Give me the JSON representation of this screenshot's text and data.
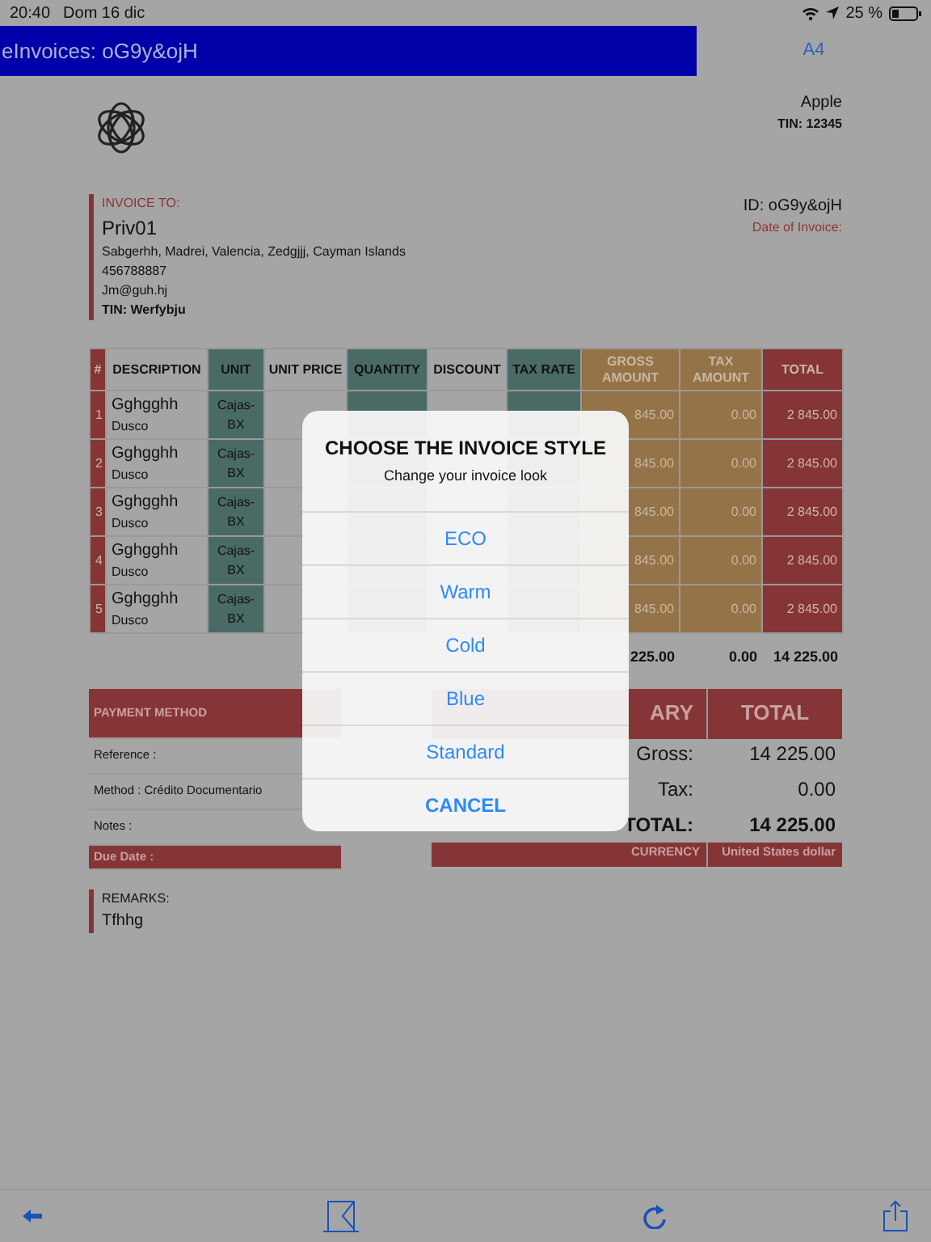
{
  "status_bar": {
    "time": "20:40",
    "date": "Dom 16 dic",
    "battery": "25 %"
  },
  "title_bar": {
    "title": "eInvoices: oG9y&ojH",
    "format_button": "A4"
  },
  "seller": {
    "name": "Apple",
    "tin": "TIN: 12345"
  },
  "bill_to": {
    "label": "INVOICE TO:",
    "name": "Priv01",
    "address": "Sabgerhh, Madrei, Valencia, Zedgjjj, Cayman Islands",
    "phone": "456788887",
    "email": "Jm@guh.hj",
    "tin": "TIN: Werfybju"
  },
  "invoice_meta": {
    "id": "ID: oG9y&ojH",
    "date_label": "Date of Invoice:"
  },
  "table": {
    "columns": [
      {
        "label": "#",
        "color": "#853535"
      },
      {
        "label": "DESCRIPTION",
        "color": "#a5a5a5"
      },
      {
        "label": "UNIT",
        "color": "#4a6a66"
      },
      {
        "label": "UNIT PRICE",
        "color": "#a5a5a5"
      },
      {
        "label": "QUANTITY",
        "color": "#4a6a66"
      },
      {
        "label": "DISCOUNT",
        "color": "#a5a5a5"
      },
      {
        "label": "TAX RATE",
        "color": "#4a6a66"
      },
      {
        "label": "GROSS AMOUNT",
        "color": "#957348"
      },
      {
        "label": "TAX AMOUNT",
        "color": "#957348"
      },
      {
        "label": "TOTAL",
        "color": "#853535"
      }
    ],
    "rows": [
      {
        "number": "1",
        "name": "Gghgghh",
        "detail": "Dusco",
        "unit": "Cajas-BX",
        "gross": "845.00",
        "tax": "0.00",
        "total": "2 845.00"
      },
      {
        "number": "2",
        "name": "Gghgghh",
        "detail": "Dusco",
        "unit": "Cajas-BX",
        "gross": "845.00",
        "tax": "0.00",
        "total": "2 845.00"
      },
      {
        "number": "3",
        "name": "Gghgghh",
        "detail": "Dusco",
        "unit": "Cajas-BX",
        "gross": "845.00",
        "tax": "0.00",
        "total": "2 845.00"
      },
      {
        "number": "4",
        "name": "Gghgghh",
        "detail": "Dusco",
        "unit": "Cajas-BX",
        "gross": "845.00",
        "tax": "0.00",
        "total": "2 845.00"
      },
      {
        "number": "5",
        "name": "Gghgghh",
        "detail": "Dusco",
        "unit": "Cajas-BX",
        "gross": "845.00",
        "tax": "0.00",
        "total": "2 845.00"
      }
    ],
    "totals": {
      "gross": "225.00",
      "tax": "0.00",
      "total": "14 225.00"
    }
  },
  "payment": {
    "title": "PAYMENT METHOD",
    "lines": [
      "Reference :",
      "Method : Crédito Documentario",
      "Notes :"
    ],
    "due_date": "Due Date :"
  },
  "summary": {
    "title": "ARY",
    "total_heading": "TOTAL",
    "lines": [
      {
        "kind": "plain",
        "label": "Gross:",
        "value": "14 225.00"
      },
      {
        "kind": "plain",
        "label": "Tax:",
        "value": "0.00"
      },
      {
        "kind": "grand",
        "label": "TOTAL:",
        "value": "14 225.00"
      }
    ],
    "currency_label": "CURRENCY",
    "currency": "United States dollar"
  },
  "remarks": {
    "label": "REMARKS:",
    "text": "Tfhhg"
  },
  "dialog": {
    "title": "CHOOSE THE INVOICE STYLE",
    "subtitle": "Change your invoice look",
    "options": [
      {
        "kind": "option",
        "label": "ECO"
      },
      {
        "kind": "option",
        "label": "Warm"
      },
      {
        "kind": "option",
        "label": "Cold"
      },
      {
        "kind": "option",
        "label": "Blue"
      },
      {
        "kind": "option",
        "label": "Standard"
      },
      {
        "kind": "cancel",
        "label": "CANCEL"
      }
    ]
  }
}
